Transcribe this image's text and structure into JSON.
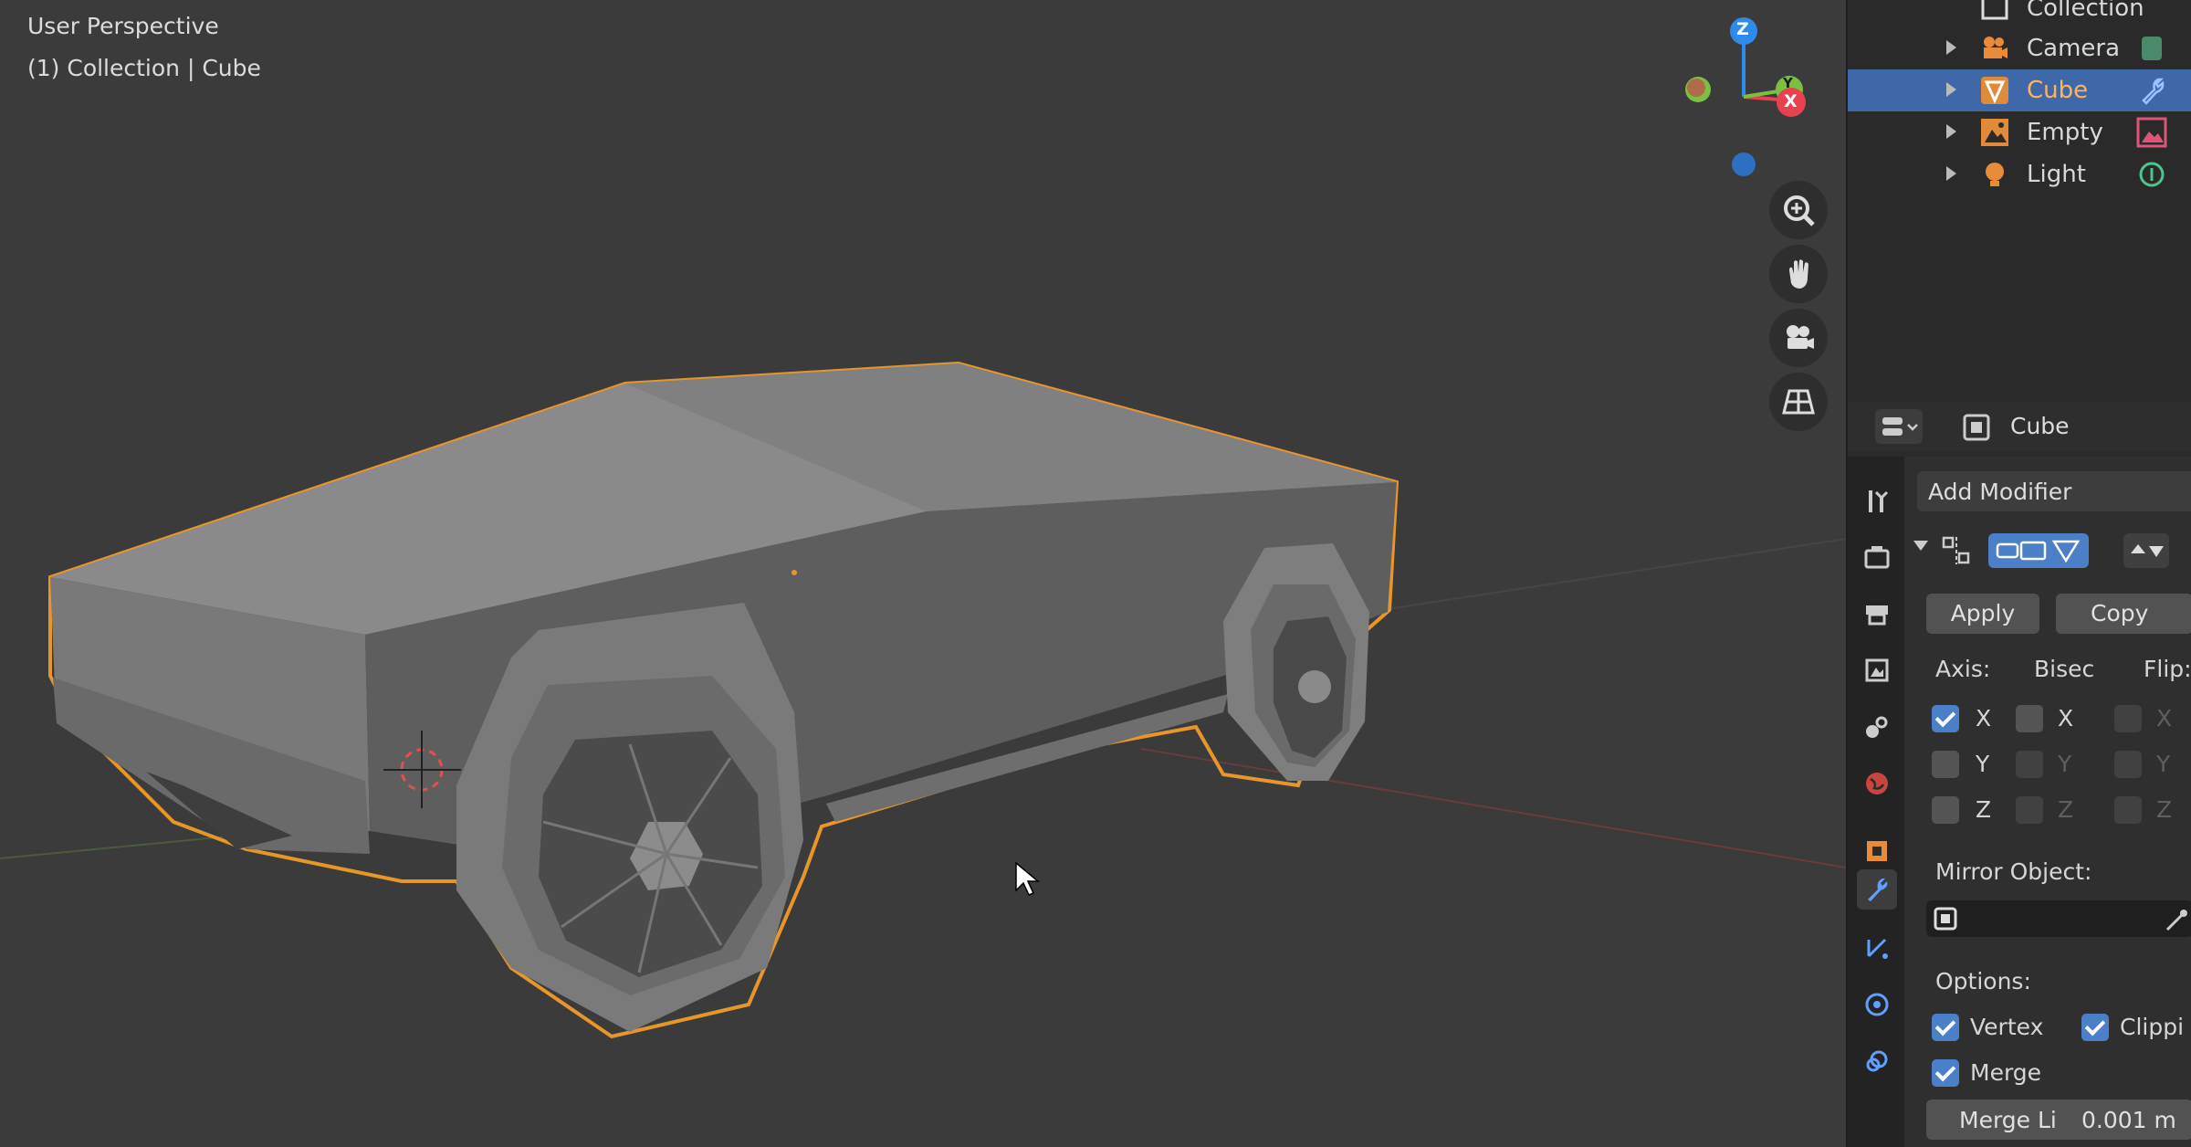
{
  "viewport": {
    "view_name": "User Perspective",
    "collection_info": "(1) Collection | Cube",
    "gizmo": {
      "z_label": "Z",
      "x_label": "X",
      "y_label": "Y"
    }
  },
  "outliner": {
    "items": [
      {
        "label": "Collection",
        "icon": "collection-icon",
        "selected": false
      },
      {
        "label": "Camera",
        "icon": "camera-icon",
        "selected": false
      },
      {
        "label": "Cube",
        "icon": "mesh-icon",
        "selected": true
      },
      {
        "label": "Empty",
        "icon": "image-empty-icon",
        "selected": false
      },
      {
        "label": "Light",
        "icon": "light-icon",
        "selected": false
      }
    ]
  },
  "properties": {
    "object_name": "Cube",
    "add_modifier_label": "Add Modifier",
    "apply_label": "Apply",
    "copy_label": "Copy",
    "axis_header": "Axis:",
    "bisect_header": "Bisec",
    "flip_header": "Flip:",
    "axis_x": "X",
    "axis_y": "Y",
    "axis_z": "Z",
    "mirror_object_label": "Mirror Object:",
    "options_label": "Options:",
    "vertex_label": "Vertex",
    "clipping_label": "Clippi",
    "merge_label": "Merge",
    "merge_limit_label": "Merge Li",
    "merge_limit_value": "0.001 m"
  },
  "colors": {
    "selection_outline": "#e8962a",
    "selected_row": "#3f68a8",
    "checkbox_on": "#4b7fc8",
    "axis_x": "#e8424f",
    "axis_y": "#7bc043",
    "axis_z": "#2d8ceb"
  }
}
